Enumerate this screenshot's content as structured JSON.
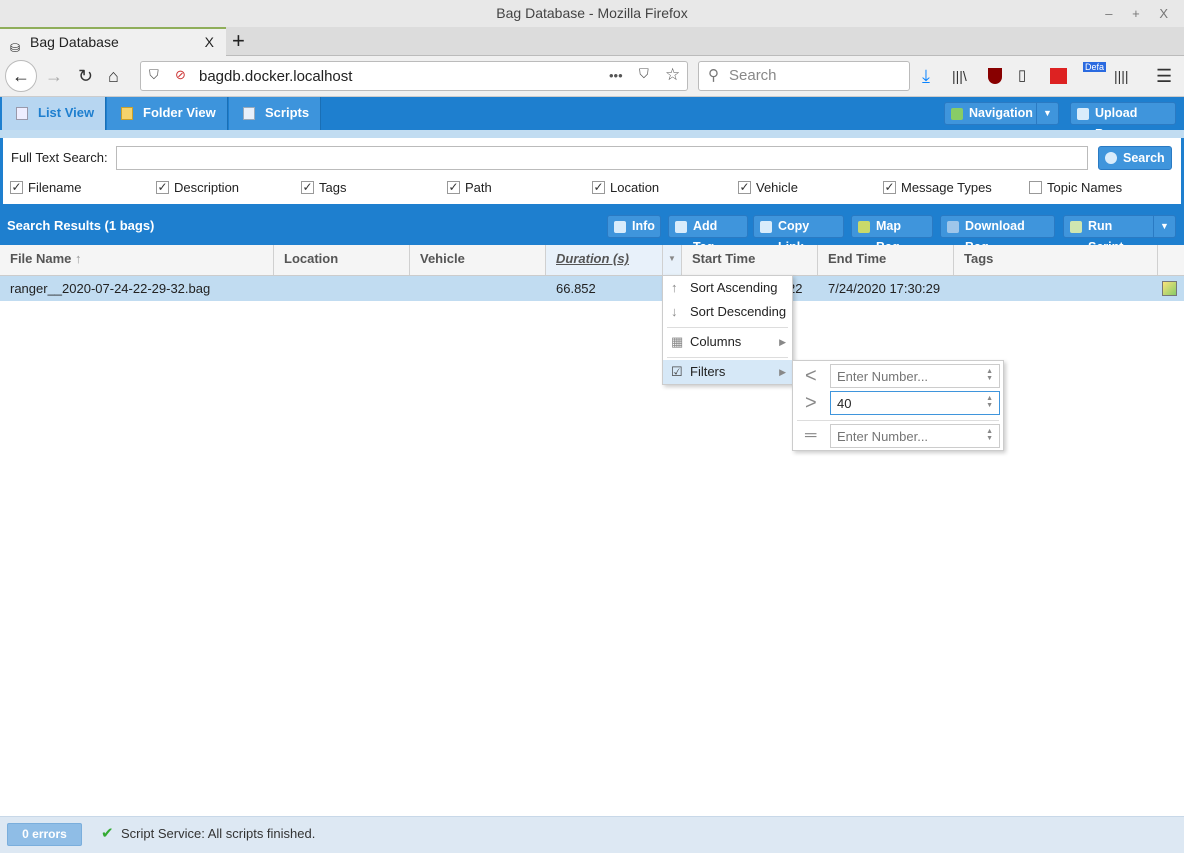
{
  "window": {
    "title": "Bag Database - Mozilla Firefox",
    "controls": "– + X"
  },
  "browser": {
    "tab_title": "Bag Database",
    "close": "X",
    "new_tab": "+",
    "url": "bagdb.docker.localhost",
    "search_placeholder": "Search",
    "page_actions": "•••",
    "ext_badge": "Defa"
  },
  "app": {
    "tabs": [
      {
        "label": "List View",
        "active": true
      },
      {
        "label": "Folder View"
      },
      {
        "label": "Scripts"
      }
    ],
    "navigation_label": "Navigation",
    "upload_label": "Upload Bags",
    "search": {
      "label": "Full Text Search:",
      "value": "",
      "button": "Search",
      "fields": [
        {
          "label": "Filename",
          "checked": true
        },
        {
          "label": "Description",
          "checked": true
        },
        {
          "label": "Tags",
          "checked": true
        },
        {
          "label": "Path",
          "checked": true
        },
        {
          "label": "Location",
          "checked": true
        },
        {
          "label": "Vehicle",
          "checked": true
        },
        {
          "label": "Message Types",
          "checked": true
        },
        {
          "label": "Topic Names",
          "checked": false
        }
      ]
    },
    "results": {
      "title": "Search Results (1 bags)",
      "actions": [
        "Info",
        "Add Tag",
        "Copy Link",
        "Map Bag",
        "Download Bag",
        "Run Script"
      ]
    },
    "grid": {
      "columns": [
        "File Name",
        "Location",
        "Vehicle",
        "Duration (s)",
        "Start Time",
        "End Time",
        "Tags"
      ],
      "sort_column": "File Name",
      "sort_dir": "ascending",
      "rows": [
        {
          "file": "ranger__2020-07-24-22-29-32.bag",
          "location": "",
          "vehicle": "",
          "duration": "66.852",
          "start": "22",
          "end": "7/24/2020 17:30:29",
          "tags": ""
        }
      ]
    },
    "column_menu": {
      "items": [
        "Sort Ascending",
        "Sort Descending",
        "Columns",
        "Filters"
      ],
      "filters_checked": true
    },
    "filter": {
      "lt": {
        "value": "",
        "placeholder": "Enter Number..."
      },
      "gt": {
        "value": "40",
        "placeholder": "Enter Number..."
      },
      "eq": {
        "value": "",
        "placeholder": "Enter Number..."
      }
    },
    "status": {
      "errors": "0 errors",
      "message": "Script Service: All scripts finished."
    }
  },
  "colors": {
    "accent": "#1e7fcf",
    "selected_row": "#c1dcf1",
    "button": "#3f95dc"
  }
}
